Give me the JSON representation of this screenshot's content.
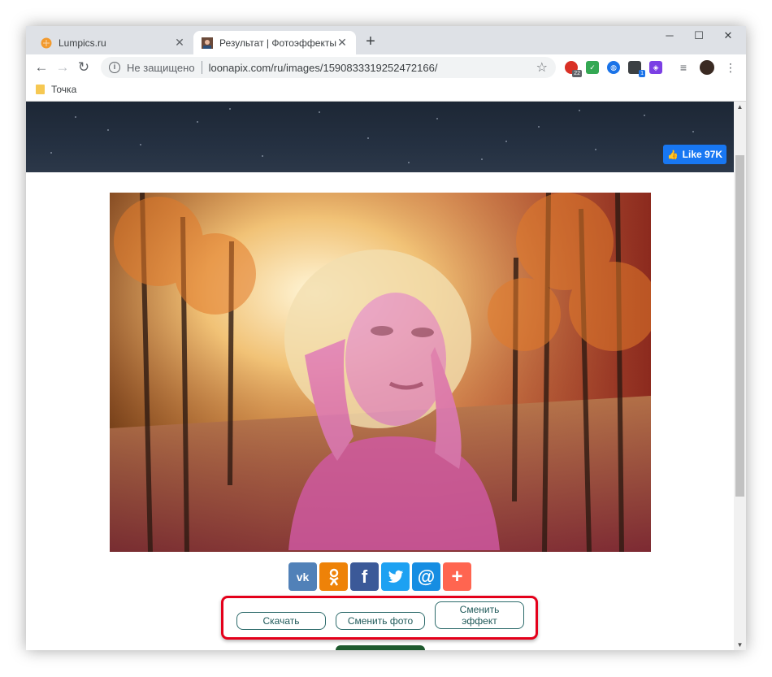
{
  "browser": {
    "tabs": [
      {
        "title": "Lumpics.ru",
        "active": false
      },
      {
        "title": "Результат | Фотоэффекты онлайн",
        "active": true
      }
    ],
    "address": {
      "security_label": "Не защищено",
      "url": "loonapix.com/ru/images/1590833319252472166/"
    },
    "extensions": [
      {
        "name": "ext-red-icon",
        "badge": "22",
        "color": "#d93025"
      },
      {
        "name": "ext-green-check-icon",
        "badge": "",
        "color": "#34a853"
      },
      {
        "name": "ext-globe-icon",
        "badge": "",
        "color": "#1a73e8"
      },
      {
        "name": "ext-cube-icon",
        "badge": "1",
        "color": "#3c4043"
      },
      {
        "name": "ext-purple-icon",
        "badge": "",
        "color": "#7b3fe4"
      }
    ],
    "bookmarks": [
      {
        "label": "Точка"
      }
    ]
  },
  "page": {
    "fb_like_label": "Like 97K",
    "social": [
      {
        "name": "vk",
        "glyph": "vk",
        "color": "#5181b8"
      },
      {
        "name": "odnoklassniki",
        "glyph": "ok",
        "color": "#ee8208"
      },
      {
        "name": "facebook",
        "glyph": "f",
        "color": "#3b5998"
      },
      {
        "name": "twitter",
        "glyph": "t",
        "color": "#1da1f2"
      },
      {
        "name": "mailru",
        "glyph": "@",
        "color": "#168de2"
      },
      {
        "name": "more",
        "glyph": "+",
        "color": "#ff6550"
      }
    ],
    "buttons": {
      "download": "Скачать",
      "change_photo": "Сменить фото",
      "change_effect_line1": "Сменить",
      "change_effect_line2": "эффект"
    }
  },
  "colors": {
    "highlight": "#e4001b",
    "button_border": "#2d6b6b",
    "facebook_like": "#1877f2"
  }
}
